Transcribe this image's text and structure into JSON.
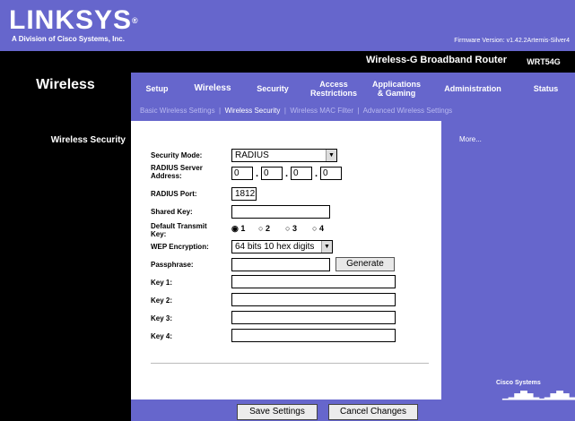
{
  "brand": {
    "logo": "LINKSYS",
    "logo_mark": "®",
    "sub": "A Division of Cisco Systems, Inc."
  },
  "firmware": "Firmware Version: v1.42.2Artemis-Silver4",
  "product": {
    "name": "Wireless-G Broadband Router",
    "model": "WRT54G"
  },
  "section": "Wireless",
  "tabs": [
    {
      "label": "Setup"
    },
    {
      "label": "Wireless"
    },
    {
      "label": "Security"
    },
    {
      "label": "Access\nRestrictions"
    },
    {
      "label": "Applications\n& Gaming"
    },
    {
      "label": "Administration"
    },
    {
      "label": "Status"
    }
  ],
  "subnav": {
    "items": [
      "Basic Wireless Settings",
      "Wireless Security",
      "Wireless MAC Filter",
      "Advanced Wireless Settings"
    ],
    "separator": "|"
  },
  "left_header": "Wireless Security",
  "right": {
    "more": "More..."
  },
  "cisco": "Cisco Systems",
  "form": {
    "security_mode_label": "Security Mode:",
    "security_mode_value": "RADIUS",
    "radius_addr_label": "RADIUS Server\nAddress:",
    "ip": [
      "0",
      "0",
      "0",
      "0"
    ],
    "ip_dot": ".",
    "radius_port_label": "RADIUS Port:",
    "radius_port_value": "1812",
    "shared_key_label": "Shared Key:",
    "default_key_label": "Default Transmit\nKey:",
    "radio_options": [
      "1",
      "2",
      "3",
      "4"
    ],
    "radio_selected": "1",
    "wep_label": "WEP Encryption:",
    "wep_value": "64 bits 10 hex digits",
    "passphrase_label": "Passphrase:",
    "generate_label": "Generate",
    "key_labels": [
      "Key 1:",
      "Key 2:",
      "Key 3:",
      "Key 4:"
    ]
  },
  "buttons": {
    "save": "Save Settings",
    "cancel": "Cancel Changes"
  },
  "icons": {
    "dropdown": "chevron-down-icon"
  }
}
